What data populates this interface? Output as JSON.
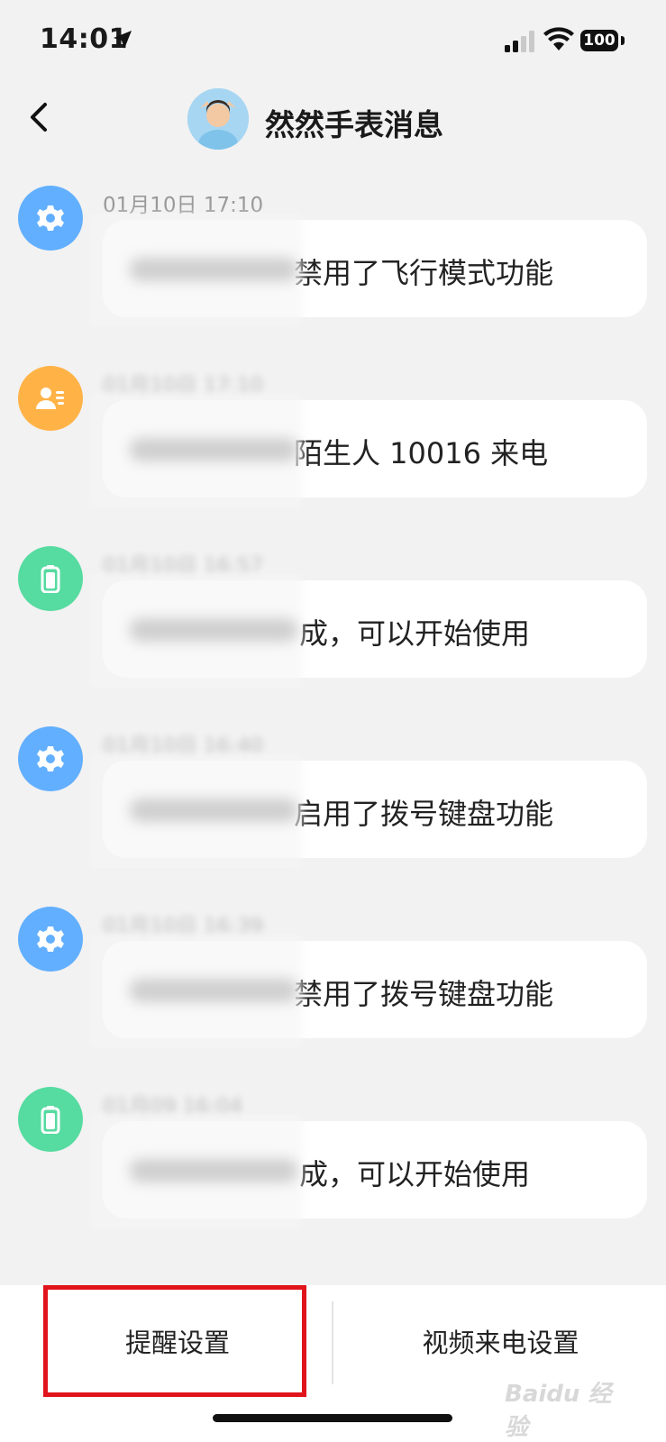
{
  "status_bar": {
    "time": "14:01",
    "battery": "100"
  },
  "header": {
    "title": "然然手表消息"
  },
  "messages": [
    {
      "time": "01月10日 17:10",
      "text": "禁用了飞行模式功能",
      "icon": "gear-icon",
      "color": "#62afff"
    },
    {
      "time": "",
      "text": "陌生人 10016 来电",
      "icon": "contact-card-icon",
      "color": "#ffb347"
    },
    {
      "time": "",
      "text": "成，可以开始使用",
      "icon": "battery-icon",
      "color": "#56dba0"
    },
    {
      "time": "",
      "text": "启用了拨号键盘功能",
      "icon": "gear-icon",
      "color": "#62afff"
    },
    {
      "time": "",
      "text": "禁用了拨号键盘功能",
      "icon": "gear-icon",
      "color": "#62afff"
    },
    {
      "time": "",
      "text": "成，可以开始使用",
      "icon": "battery-icon",
      "color": "#56dba0"
    }
  ],
  "bottom_bar": {
    "reminder_settings": "提醒设置",
    "video_call_settings": "视频来电设置",
    "highlight_color": "#e0141b"
  },
  "watermark": "Baidu 经验"
}
